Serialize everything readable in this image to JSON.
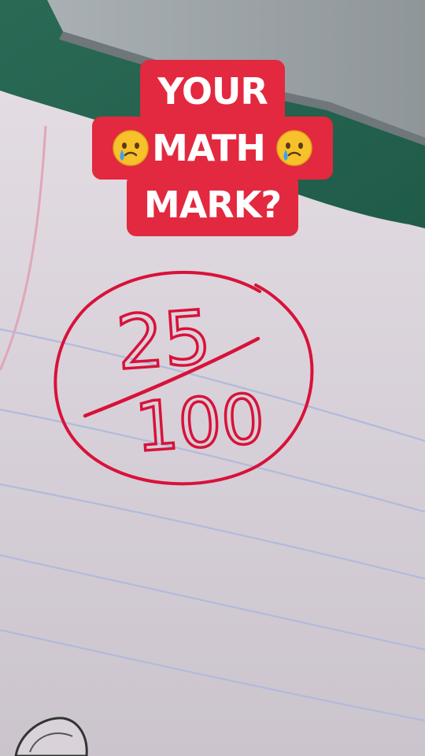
{
  "caption": {
    "line1": "YOUR",
    "line2_emoji_left": "face-holding-back-tears-icon",
    "line2_text": "MATH",
    "line2_emoji_right": "face-holding-back-tears-icon",
    "line3": "MARK?"
  },
  "handwriting": {
    "numerator": "25",
    "denominator": "100",
    "ink_color": "#d8123a"
  },
  "colors": {
    "caption_bg": "#e2293f",
    "caption_text": "#ffffff",
    "paper": "#ddd6dd",
    "desk_green": "#2e6b55",
    "ruled_line": "#a9b4d8"
  }
}
